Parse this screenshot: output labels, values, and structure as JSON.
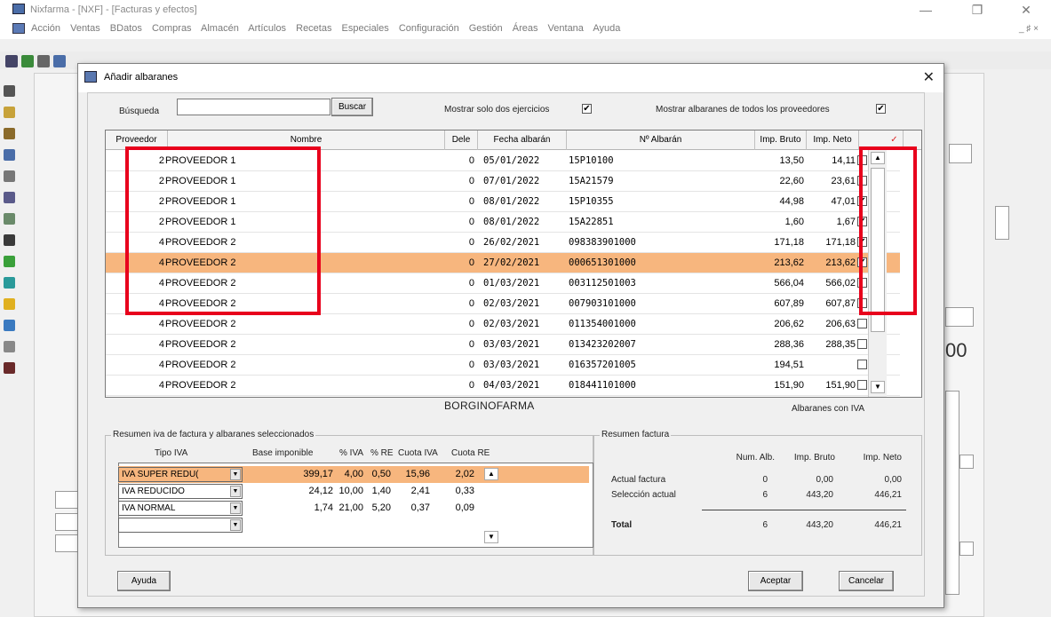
{
  "app": {
    "title": "Nixfarma - [NXF] - [Facturas y efectos]",
    "menu": [
      "Acción",
      "Ventas",
      "BDatos",
      "Compras",
      "Almacén",
      "Artículos",
      "Recetas",
      "Especiales",
      "Configuración",
      "Gestión",
      "Áreas",
      "Ventana",
      "Ayuda"
    ],
    "menu_right": "_ ♯ ×",
    "bg_value": "00"
  },
  "dialog": {
    "title": "Añadir albaranes",
    "search_label": "Búsqueda",
    "search_value": "",
    "search_button": "Buscar",
    "opt_two_years_label": "Mostrar solo dos ejercicios",
    "opt_two_years_checked": "✔",
    "opt_all_suppliers_label": "Mostrar albaranes de todos los proveedores",
    "opt_all_suppliers_checked": "✔",
    "grid": {
      "headers": [
        "Proveedor",
        "Nombre",
        "Dele",
        "Fecha albarán",
        "Nº Albarán",
        "Imp. Bruto",
        "Imp. Neto",
        "✓"
      ],
      "rows": [
        {
          "proveedor": "2",
          "nombre": "PROVEEDOR 1",
          "dele": "0",
          "fecha": "05/01/2022",
          "albaran": "15P10100",
          "bruto": "13,50",
          "neto": "14,11",
          "check": ""
        },
        {
          "proveedor": "2",
          "nombre": "PROVEEDOR 1",
          "dele": "0",
          "fecha": "07/01/2022",
          "albaran": "15A21579",
          "bruto": "22,60",
          "neto": "23,61",
          "check": ""
        },
        {
          "proveedor": "2",
          "nombre": "PROVEEDOR 1",
          "dele": "0",
          "fecha": "08/01/2022",
          "albaran": "15P10355",
          "bruto": "44,98",
          "neto": "47,01",
          "check": "✔"
        },
        {
          "proveedor": "2",
          "nombre": "PROVEEDOR 1",
          "dele": "0",
          "fecha": "08/01/2022",
          "albaran": "15A22851",
          "bruto": "1,60",
          "neto": "1,67",
          "check": "✔"
        },
        {
          "proveedor": "4",
          "nombre": "PROVEEDOR 2",
          "dele": "0",
          "fecha": "26/02/2021",
          "albaran": "098383901000",
          "bruto": "171,18",
          "neto": "171,18",
          "check": "✔"
        },
        {
          "proveedor": "4",
          "nombre": "PROVEEDOR 2",
          "dele": "0",
          "fecha": "27/02/2021",
          "albaran": "000651301000",
          "bruto": "213,62",
          "neto": "213,62",
          "check": "✔"
        },
        {
          "proveedor": "4",
          "nombre": "PROVEEDOR 2",
          "dele": "0",
          "fecha": "01/03/2021",
          "albaran": "003112501003",
          "bruto": "566,04",
          "neto": "566,02",
          "check": ""
        },
        {
          "proveedor": "4",
          "nombre": "PROVEEDOR 2",
          "dele": "0",
          "fecha": "02/03/2021",
          "albaran": "007903101000",
          "bruto": "607,89",
          "neto": "607,87",
          "check": ""
        },
        {
          "proveedor": "4",
          "nombre": "PROVEEDOR 2",
          "dele": "0",
          "fecha": "02/03/2021",
          "albaran": "011354001000",
          "bruto": "206,62",
          "neto": "206,63",
          "check": ""
        },
        {
          "proveedor": "4",
          "nombre": "PROVEEDOR 2",
          "dele": "0",
          "fecha": "03/03/2021",
          "albaran": "013423202007",
          "bruto": "288,36",
          "neto": "288,35",
          "check": ""
        },
        {
          "proveedor": "4",
          "nombre": "PROVEEDOR 2",
          "dele": "0",
          "fecha": "03/03/2021",
          "albaran": "016357201005",
          "bruto": "194,51",
          "neto": "",
          "check": ""
        },
        {
          "proveedor": "4",
          "nombre": "PROVEEDOR 2",
          "dele": "0",
          "fecha": "04/03/2021",
          "albaran": "018441101000",
          "bruto": "151,90",
          "neto": "151,90",
          "check": ""
        }
      ]
    },
    "grid_footer_center": "BORGINOFARMA",
    "grid_footer_right": "Albaranes con IVA",
    "iva_summary": {
      "legend": "Resumen iva de factura y albaranes seleccionados",
      "headers": [
        "Tipo IVA",
        "Base imponible",
        "% IVA",
        "% RE",
        "Cuota IVA",
        "Cuota RE"
      ],
      "rows": [
        {
          "tipo": "IVA SUPER REDU(",
          "base": "399,17",
          "iva": "4,00",
          "re": "0,50",
          "cuota_iva": "15,96",
          "cuota_re": "2,02"
        },
        {
          "tipo": "IVA REDUCIDO",
          "base": "24,12",
          "iva": "10,00",
          "re": "1,40",
          "cuota_iva": "2,41",
          "cuota_re": "0,33"
        },
        {
          "tipo": "IVA NORMAL",
          "base": "1,74",
          "iva": "21,00",
          "re": "5,20",
          "cuota_iva": "0,37",
          "cuota_re": "0,09"
        },
        {
          "tipo": "",
          "base": "",
          "iva": "",
          "re": "",
          "cuota_iva": "",
          "cuota_re": ""
        }
      ]
    },
    "invoice_summary": {
      "legend": "Resumen factura",
      "headers": [
        "Num. Alb.",
        "Imp. Bruto",
        "Imp. Neto"
      ],
      "rows": [
        {
          "label": "Actual factura",
          "num": "0",
          "bruto": "0,00",
          "neto": "0,00"
        },
        {
          "label": "Selección actual",
          "num": "6",
          "bruto": "443,20",
          "neto": "446,21"
        },
        {
          "label": "Total",
          "num": "6",
          "bruto": "443,20",
          "neto": "446,21"
        }
      ]
    },
    "buttons": {
      "help": "Ayuda",
      "accept": "Aceptar",
      "cancel": "Cancelar"
    }
  },
  "colors": {
    "selection": "#f7b67e",
    "highlight_box": "#e8001c"
  }
}
